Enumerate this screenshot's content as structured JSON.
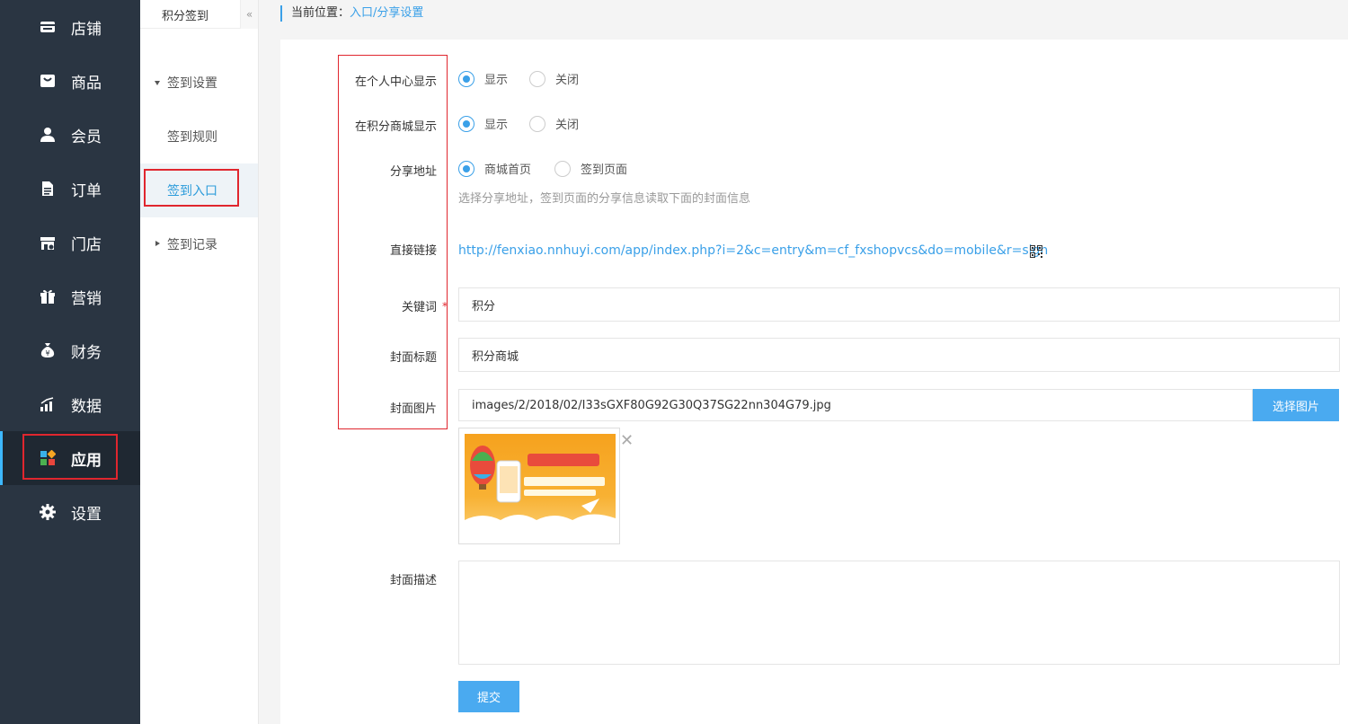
{
  "sidebar": {
    "items": [
      {
        "label": "店铺",
        "icon": "store-icon"
      },
      {
        "label": "商品",
        "icon": "goods-icon"
      },
      {
        "label": "会员",
        "icon": "member-icon"
      },
      {
        "label": "订单",
        "icon": "order-icon"
      },
      {
        "label": "门店",
        "icon": "shop-icon"
      },
      {
        "label": "营销",
        "icon": "gift-icon"
      },
      {
        "label": "财务",
        "icon": "money-bag-icon"
      },
      {
        "label": "数据",
        "icon": "chart-icon"
      },
      {
        "label": "应用",
        "icon": "apps-icon"
      },
      {
        "label": "设置",
        "icon": "gear-icon"
      }
    ],
    "active_index": 8
  },
  "subnav": {
    "title": "积分签到",
    "collapse_glyph": "«",
    "items": [
      {
        "label": "签到设置",
        "type": "group"
      },
      {
        "label": "签到规则",
        "type": "child"
      },
      {
        "label": "签到入口",
        "type": "child",
        "active": true
      },
      {
        "label": "签到记录",
        "type": "group"
      }
    ]
  },
  "breadcrumb": {
    "prefix": "当前位置：",
    "path": "入口/分享设置"
  },
  "form": {
    "show_in_center": {
      "label": "在个人中心显示",
      "options": [
        "显示",
        "关闭"
      ],
      "selected": 0
    },
    "show_in_mall": {
      "label": "在积分商城显示",
      "options": [
        "显示",
        "关闭"
      ],
      "selected": 0
    },
    "share_url": {
      "label": "分享地址",
      "options": [
        "商城首页",
        "签到页面"
      ],
      "selected": 0,
      "help": "选择分享地址，签到页面的分享信息读取下面的封面信息"
    },
    "direct_link": {
      "label": "直接链接",
      "url": "http://fenxiao.nnhuyi.com/app/index.php?i=2&c=entry&m=cf_fxshopvcs&do=mobile&r=sign"
    },
    "keyword": {
      "label": "关键词",
      "required_mark": "*",
      "value": "积分"
    },
    "cover_title": {
      "label": "封面标题",
      "value": "积分商城"
    },
    "cover_image": {
      "label": "封面图片",
      "value": "images/2/2018/02/I33sGXF80G92G30Q37SG22nn304G79.jpg",
      "button": "选择图片",
      "close_glyph": "✕"
    },
    "cover_desc": {
      "label": "封面描述",
      "value": ""
    },
    "submit": "提交"
  },
  "colors": {
    "accent": "#3aa0e8",
    "sidebar_bg": "#2a3542",
    "highlight_box": "#e0262e"
  }
}
